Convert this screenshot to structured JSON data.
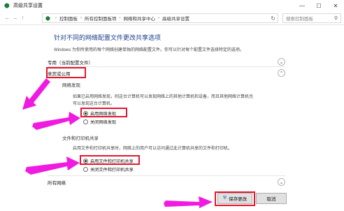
{
  "window": {
    "title": "高级共享设置",
    "min_icon": "minimize-icon",
    "max_icon": "maximize-icon",
    "close_icon": "close-icon"
  },
  "address": {
    "breadcrumbs": [
      "控制面板",
      "所有控制面板项",
      "网络和共享中心",
      "高级共享设置"
    ],
    "search_placeholder": "搜索控制面板"
  },
  "page": {
    "heading": "针对不同的网络配置文件更改共享选项",
    "description": "Windows 为你所使用的每个网络创建单独的网络配置文件。你可以针对每个配置文件选择特定的选项。",
    "profiles": {
      "private_label": "专用（当前配置文件）",
      "guest_label": "来宾或公用",
      "all_label": "所有网络"
    },
    "network_discovery": {
      "title": "网络发现",
      "text_line1": "如果已启用网络发现，则这台计算机可以发现网络上的其他计算机和设备，而且其他网络计算机也",
      "text_line2": "可以发现这台计算机。",
      "opt_on": "启用网络发现",
      "opt_off": "关闭网络发现",
      "selected": "启用网络发现"
    },
    "file_printer": {
      "title": "文件和打印机共享",
      "text": "启用文件和打印机共享时，网络上的用户可以访问通过此计算机共享的文件和打印机。",
      "opt_on": "启用文件和打印机共享",
      "opt_off": "关闭文件和打印机共享",
      "selected": "启用文件和打印机共享"
    }
  },
  "footer": {
    "save_label": "保存更改",
    "cancel_label": "取消"
  },
  "colors": {
    "highlight": "#e5162d",
    "arrow": "#f01be0",
    "link": "#1a3e8c"
  }
}
